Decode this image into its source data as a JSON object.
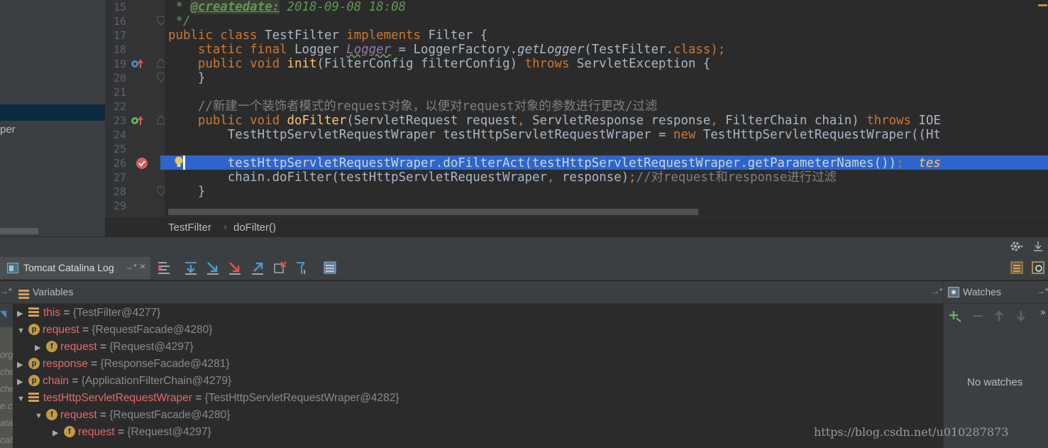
{
  "left_panel": {
    "item": "per"
  },
  "editor": {
    "line_numbers": [
      "15",
      "16",
      "17",
      "18",
      "19",
      "20",
      "21",
      "22",
      "23",
      "24",
      "25",
      "26",
      "27",
      "28",
      "29"
    ],
    "lines": {
      "l15_star": " * ",
      "l15_tag": "@createdate:",
      "l15_val": " 2018-09-08 18:08",
      "l16": " */",
      "l17_a": "public class ",
      "l17_b": "TestFilter ",
      "l17_c": "implements ",
      "l17_d": "Filter {",
      "l18_a": "    static final ",
      "l18_b": "Logger ",
      "l18_c": "Logger",
      "l18_d": " = LoggerFactory.",
      "l18_e": "getLogger",
      "l18_f": "(TestFilter.",
      "l18_g": "class",
      "l18_h": ");",
      "l19_a": "    public void ",
      "l19_b": "init",
      "l19_c": "(FilterConfig filterConfig) ",
      "l19_d": "throws ",
      "l19_e": "ServletException {",
      "l20": "    }",
      "l22": "    //新建一个装饰者模式的request对象，以便对request对象的参数进行更改/过滤",
      "l23_a": "    public void ",
      "l23_b": "doFilter",
      "l23_c": "(ServletRequest request",
      "l23_d": ", ",
      "l23_e": "ServletResponse response",
      "l23_f": ", ",
      "l23_g": "FilterChain chain) ",
      "l23_h": "throws ",
      "l23_i": "IOE",
      "l24_a": "        TestHttpServletRequestWraper testHttpServletRequestWraper = ",
      "l24_b": "new ",
      "l24_c": "TestHttpServletRequestWraper((Ht",
      "l26_a": "        testHttpServletRequestWraper.doFilterAct(testHttpServletRequestWraper.getParameterNames())",
      "l26_b": ";  ",
      "l26_c": "tes",
      "l27_a": "        chain.doFilter(testHttpServletRequestWraper",
      "l27_b": ", ",
      "l27_c": "response)",
      "l27_d": ";",
      "l27_e": "//对request和response进行过滤",
      "l28": "    }"
    }
  },
  "breadcrumb": {
    "class_name": "TestFilter",
    "separator": "›",
    "method_name": "doFilter()"
  },
  "debug": {
    "tab_label": "Tomcat Catalina Log",
    "tab_pin": "→*",
    "tab_close": "×",
    "variables_title": "Variables",
    "watches_title": "Watches",
    "no_watches": "No watches",
    "variables": [
      {
        "indent": 0,
        "expanded": false,
        "icon": "list",
        "name": "this",
        "value": "{TestFilter@4277}"
      },
      {
        "indent": 0,
        "expanded": true,
        "icon": "p",
        "name": "request",
        "value": "{RequestFacade@4280}"
      },
      {
        "indent": 1,
        "expanded": false,
        "icon": "f",
        "name": "request",
        "value": "{Request@4297}"
      },
      {
        "indent": 0,
        "expanded": false,
        "icon": "p",
        "name": "response",
        "value": "{ResponseFacade@4281}"
      },
      {
        "indent": 0,
        "expanded": false,
        "icon": "p",
        "name": "chain",
        "value": "{ApplicationFilterChain@4279}"
      },
      {
        "indent": 0,
        "expanded": true,
        "icon": "list",
        "name": "testHttpServletRequestWraper",
        "value": "{TestHttpServletRequestWraper@4282}"
      },
      {
        "indent": 1,
        "expanded": true,
        "icon": "f",
        "name": "request",
        "value": "{RequestFacade@4280}"
      },
      {
        "indent": 2,
        "expanded": false,
        "icon": "f",
        "name": "request",
        "value": "{Request@4297}"
      }
    ],
    "frames_strip": [
      "org",
      "che",
      "che",
      "e.c",
      "ata",
      "cat"
    ]
  },
  "watermark": "https://blog.csdn.net/u010287873",
  "colors": {
    "selection": "#2f65ca",
    "keyword": "#cc7832",
    "function": "#ffc66d",
    "var_name": "#e46a6a"
  }
}
